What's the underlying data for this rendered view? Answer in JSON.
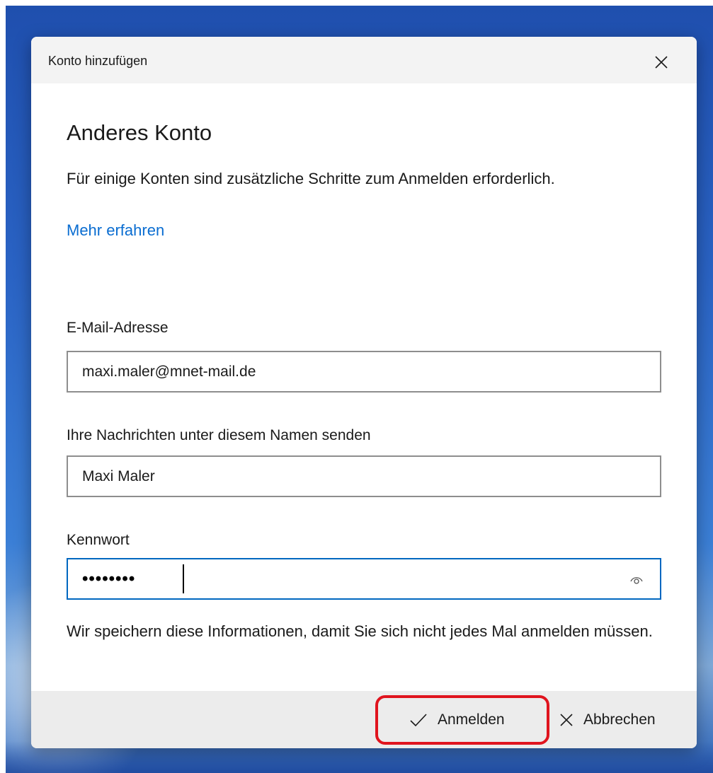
{
  "dialog": {
    "title": "Konto hinzufügen",
    "close_icon": "close-icon"
  },
  "main": {
    "heading": "Anderes Konto",
    "description": "Für einige Konten sind zusätzliche Schritte zum Anmelden erforderlich.",
    "learn_more_link": "Mehr erfahren",
    "email": {
      "label": "E-Mail-Adresse",
      "value": "maxi.maler@mnet-mail.de"
    },
    "display_name": {
      "label": "Ihre Nachrichten unter diesem Namen senden",
      "value": "Maxi Maler"
    },
    "password": {
      "label": "Kennwort",
      "masked_value": "••••••••",
      "reveal_icon": "eye-icon"
    },
    "note": "Wir speichern diese Informationen, damit Sie sich nicht jedes Mal anmelden müssen."
  },
  "footer": {
    "sign_in_label": "Anmelden",
    "sign_in_icon": "checkmark-icon",
    "cancel_label": "Abbrechen",
    "cancel_icon": "close-icon"
  },
  "colors": {
    "accent": "#0067c0",
    "link": "#0a6dd1",
    "highlight": "#e0141e"
  }
}
